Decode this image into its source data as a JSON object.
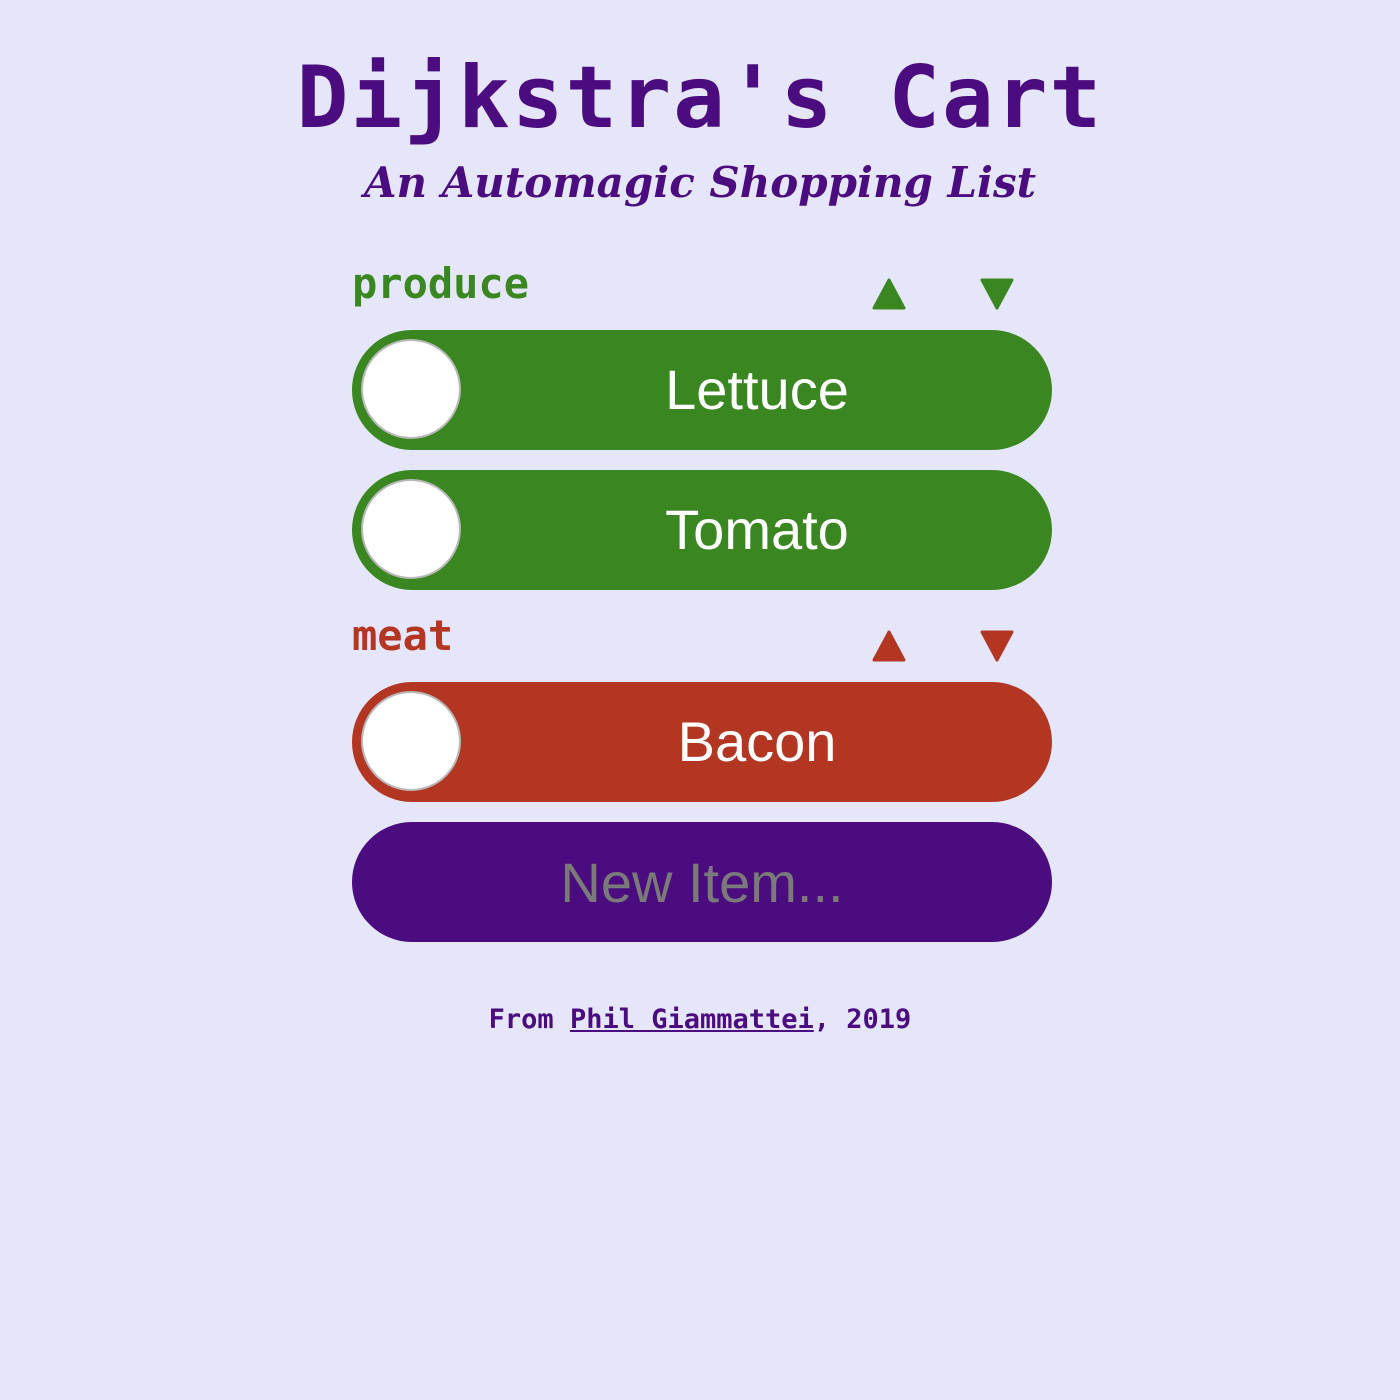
{
  "app": {
    "title": "Dijkstra's Cart",
    "subtitle": "An Automagic Shopping List"
  },
  "categories": [
    {
      "name": "produce",
      "color": "#3a8722",
      "up_icon": "triangle-up-icon",
      "down_icon": "triangle-down-icon",
      "items": [
        {
          "label": "Lettuce",
          "checked": false
        },
        {
          "label": "Tomato",
          "checked": false
        }
      ]
    },
    {
      "name": "meat",
      "color": "#b33623",
      "up_icon": "triangle-up-icon",
      "down_icon": "triangle-down-icon",
      "items": [
        {
          "label": "Bacon",
          "checked": false
        }
      ]
    }
  ],
  "new_item": {
    "placeholder": "New Item...",
    "value": "",
    "color": "#4b0c80"
  },
  "footer": {
    "prefix": "From ",
    "author": "Phil Giammattei",
    "suffix": ", 2019"
  },
  "theme": {
    "background": "#e6e6fa",
    "accent": "#4b0c80"
  }
}
